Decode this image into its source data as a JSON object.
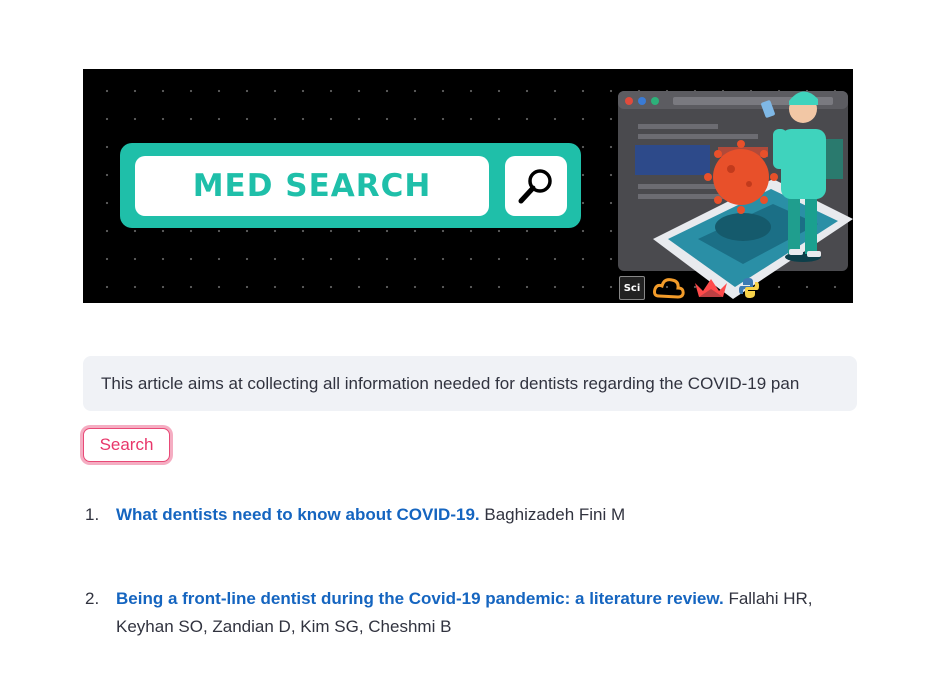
{
  "banner": {
    "title": "MED SEARCH",
    "colors": {
      "teal": "#1fbfa9",
      "background": "#000000",
      "virus": "#e8502a"
    },
    "icons": [
      "magnifier-icon",
      "sci-logo",
      "cloud-logo",
      "streamlit-logo",
      "python-logo"
    ],
    "sci_label": "Sci"
  },
  "query": {
    "value": "This article aims at collecting all information needed for dentists regarding the COVID-19 pan"
  },
  "search_button": {
    "label": "Search"
  },
  "results": [
    {
      "number": "1.",
      "title": "What dentists need to know about COVID-19.",
      "authors": "Baghizadeh Fini M"
    },
    {
      "number": "2.",
      "title": "Being a front-line dentist during the Covid-19 pandemic: a literature review.",
      "authors": "Fallahi HR, Keyhan SO, Zandian D, Kim SG, Cheshmi B"
    }
  ],
  "colors": {
    "link": "#1565c0",
    "button_accent": "#e84a77",
    "input_bg": "#f0f2f6"
  }
}
